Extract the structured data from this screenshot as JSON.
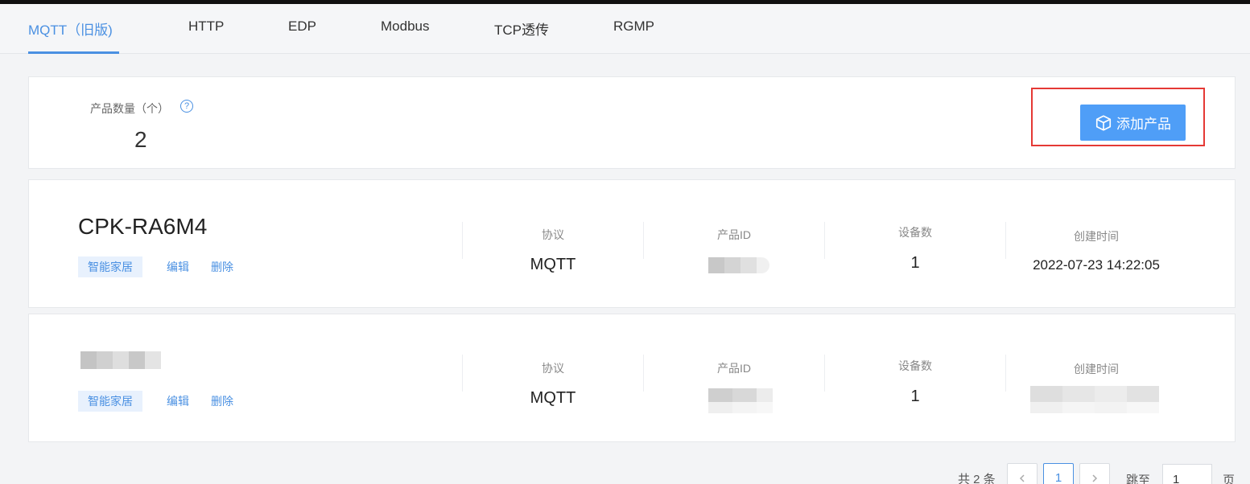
{
  "tabs": [
    {
      "label": "MQTT（旧版)",
      "active": true
    },
    {
      "label": "HTTP"
    },
    {
      "label": "EDP"
    },
    {
      "label": "Modbus"
    },
    {
      "label": "TCP透传"
    },
    {
      "label": "RGMP"
    }
  ],
  "summary": {
    "count_label": "产品数量（个）",
    "count_value": "2",
    "help_icon": "question-circle-icon",
    "add_button_label": "添加产品",
    "add_button_icon": "cube-icon",
    "accent_color": "#4f9ef7",
    "highlight_color": "#e53935"
  },
  "products": [
    {
      "name": "CPK-RA6M4",
      "tag": "智能家居",
      "edit_label": "编辑",
      "delete_label": "删除",
      "protocol_label": "协议",
      "protocol_value": "MQTT",
      "id_label": "产品ID",
      "device_count_label": "设备数",
      "device_count_value": "1",
      "created_label": "创建时间",
      "created_value": "2022-07-23 14:22:05"
    },
    {
      "tag": "智能家居",
      "edit_label": "编辑",
      "delete_label": "删除",
      "protocol_label": "协议",
      "protocol_value": "MQTT",
      "id_label": "产品ID",
      "device_count_label": "设备数",
      "device_count_value": "1",
      "created_label": "创建时间"
    }
  ],
  "pagination": {
    "total_text": "共 2 条",
    "prev_icon": "chevron-left-icon",
    "current_page": "1",
    "next_icon": "chevron-right-icon",
    "jump_label": "跳至",
    "jump_value": "1",
    "page_unit": "页"
  }
}
